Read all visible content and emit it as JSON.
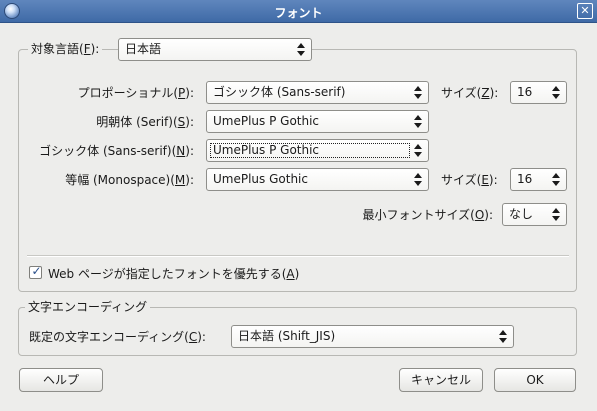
{
  "window": {
    "title": "フォント"
  },
  "fonts_group": {
    "language_label_pre": "対象言語(",
    "language_label_key": "F",
    "language_label_post": "):",
    "language_value": "日本語",
    "proportional": {
      "label_pre": "プロポーショナル(",
      "label_key": "P",
      "label_post": "):",
      "value": "ゴシック体 (Sans-serif)",
      "size_label_pre": "サイズ(",
      "size_label_key": "Z",
      "size_label_post": "):",
      "size_value": "16"
    },
    "serif": {
      "label_pre": "明朝体 (Serif)(",
      "label_key": "S",
      "label_post": "):",
      "value": "UmePlus P Gothic"
    },
    "sans": {
      "label_pre": "ゴシック体 (Sans-serif)(",
      "label_key": "N",
      "label_post": "):",
      "value": "UmePlus P Gothic"
    },
    "monospace": {
      "label_pre": "等幅 (Monospace)(",
      "label_key": "M",
      "label_post": "):",
      "value": "UmePlus Gothic",
      "size_label_pre": "サイズ(",
      "size_label_key": "E",
      "size_label_post": "):",
      "size_value": "16"
    },
    "min_size": {
      "label_pre": "最小フォントサイズ(",
      "label_key": "O",
      "label_post": "):",
      "value": "なし"
    },
    "allow_page_fonts": {
      "label_pre": "Web ページが指定したフォントを優先する(",
      "label_key": "A",
      "label_post": ")",
      "checked": true
    }
  },
  "encoding_group": {
    "title": "文字エンコーディング",
    "default_label_pre": "既定の文字エンコーディング(",
    "default_label_key": "C",
    "default_label_post": "):",
    "default_value": "日本語 (Shift_JIS)"
  },
  "buttons": {
    "help": "ヘルプ",
    "cancel": "キャンセル",
    "ok": "OK"
  },
  "icons": {
    "app": "firefox-app-icon",
    "close": "close-icon",
    "dropdown": "updown-arrows-icon",
    "check": "check-icon"
  }
}
